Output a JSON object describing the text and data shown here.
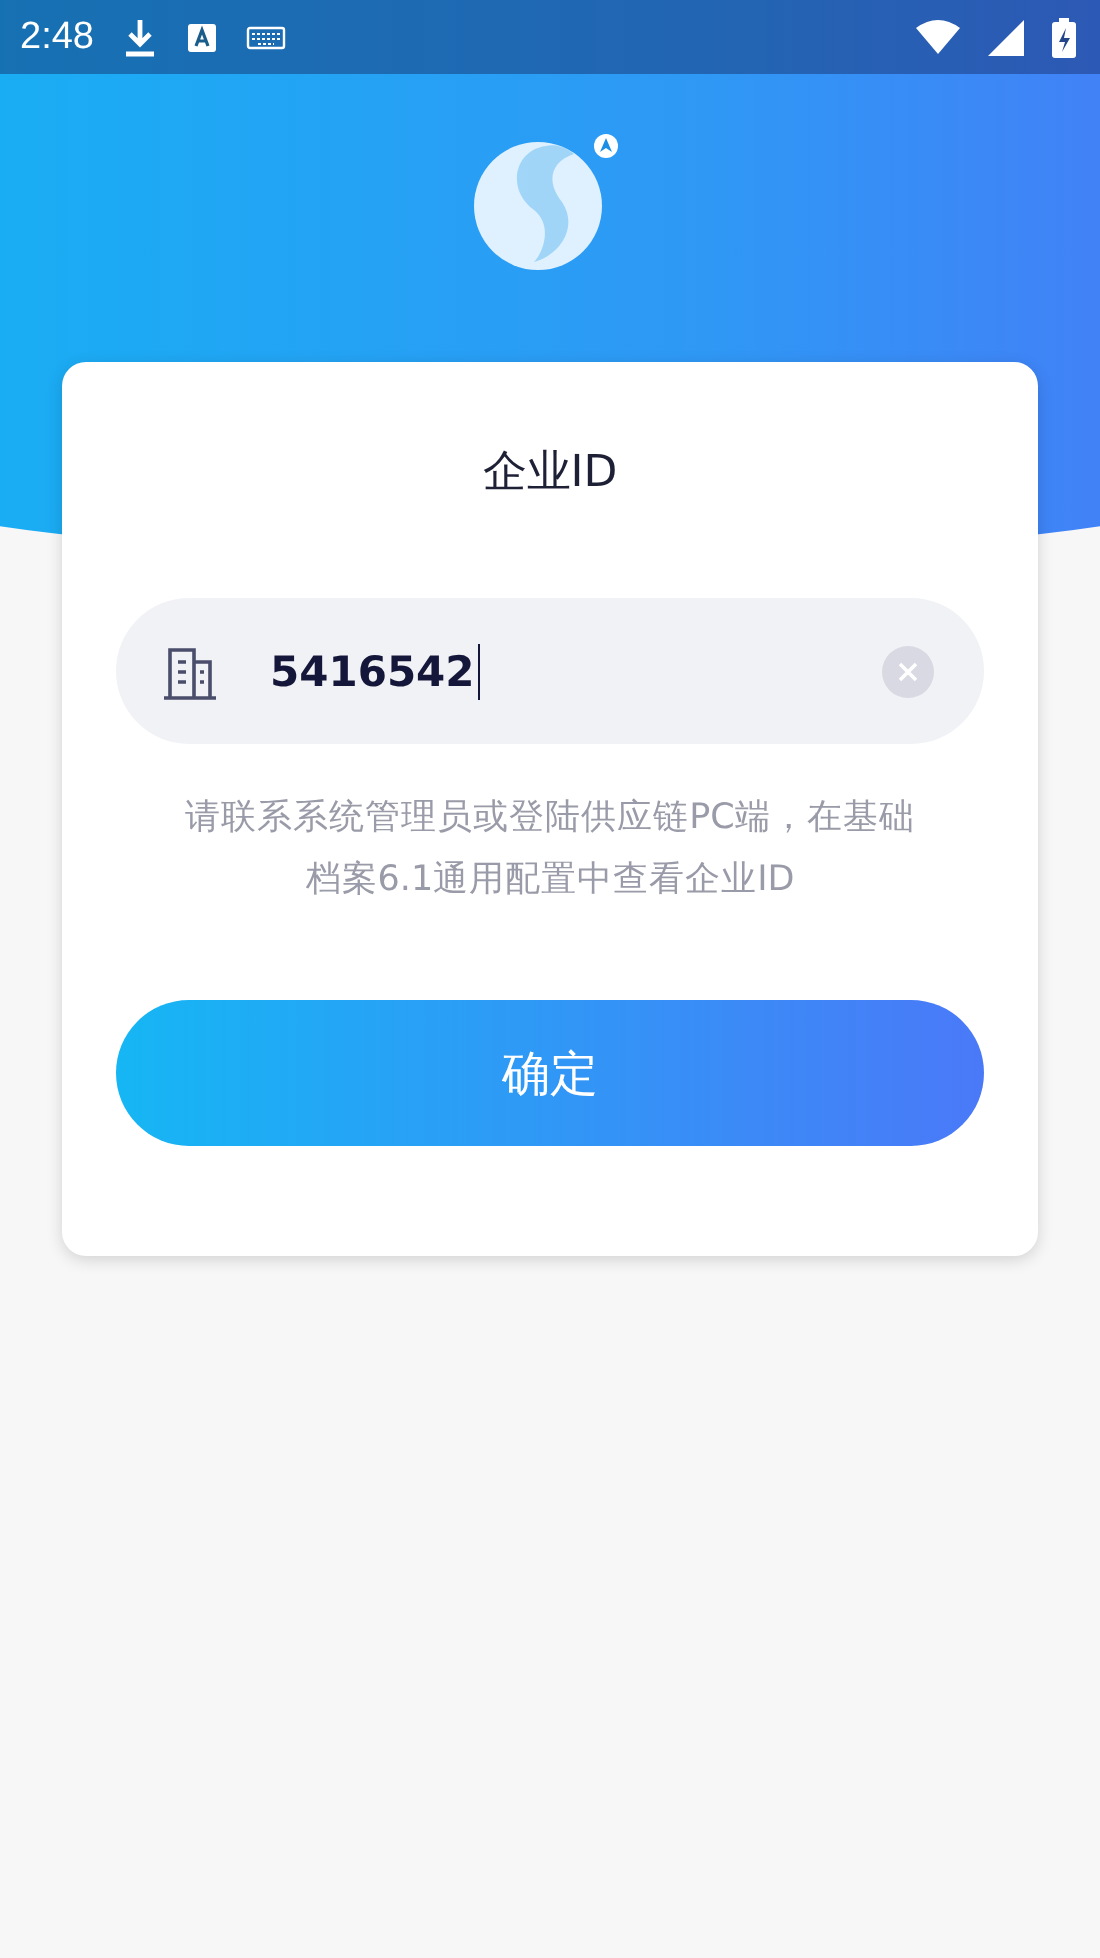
{
  "status_bar": {
    "time": "2:48"
  },
  "card": {
    "title": "企业ID",
    "field": {
      "value": "5416542"
    },
    "hint": "请联系系统管理员或登陆供应链PC端，在基础档案6.1通用配置中查看企业ID",
    "button": "确定"
  }
}
